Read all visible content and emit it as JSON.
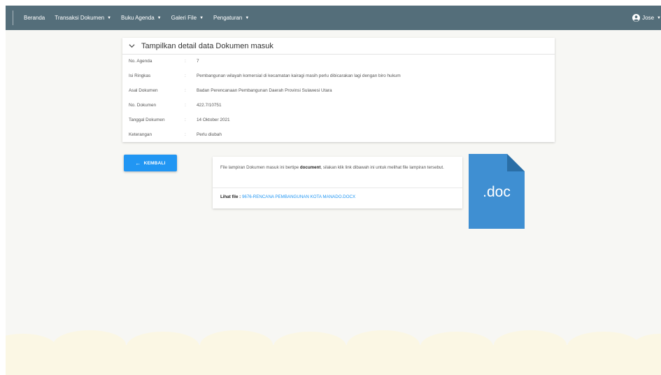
{
  "nav": {
    "items": [
      {
        "label": "Beranda",
        "dropdown": false
      },
      {
        "label": "Transaksi Dokumen",
        "dropdown": true
      },
      {
        "label": "Buku Agenda",
        "dropdown": true
      },
      {
        "label": "Galeri File",
        "dropdown": true
      },
      {
        "label": "Pengaturan",
        "dropdown": true
      }
    ],
    "user": "Jose"
  },
  "detail": {
    "title": "Tampilkan detail data Dokumen masuk",
    "rows": [
      {
        "label": "No. Agenda",
        "value": "7"
      },
      {
        "label": "Isi Ringkas",
        "value": "Pembangunan wilayah komersial di kecamatan kairagi masih perlu dibicarakan lagi dengan biro hukum"
      },
      {
        "label": "Asal Dokumen",
        "value": "Badan Perencanaan Pembangunan Daerah Provinsi Sulawesi Utara"
      },
      {
        "label": "No. Dokumen",
        "value": "422.7/10751"
      },
      {
        "label": "Tanggal Dokumen",
        "value": "14 Oktober 2021"
      },
      {
        "label": "Keterangan",
        "value": "Perlu diubah"
      }
    ],
    "colon": ":"
  },
  "back_button": {
    "label": "KEMBALI",
    "icon": "arrow-left-icon"
  },
  "attachment": {
    "text_before": "File lampiran Dokumen masuk ini bertipe ",
    "type": "document",
    "text_after": ", silakan klik link dibawah ini untuk melihat file lampiran tersebut.",
    "link_label": "Lihat file :",
    "file_name": "9676-RENCANA PEMBANGUNAN KOTA MANADO.DOCX"
  },
  "doc_icon": {
    "label": ".doc",
    "color": "#3f8fd2",
    "fold_color": "#2a6ea6"
  },
  "colors": {
    "navbar": "#546e7a",
    "accent": "#2196f3",
    "background": "#f7f7f4",
    "clouds": "#fbf7e4"
  }
}
